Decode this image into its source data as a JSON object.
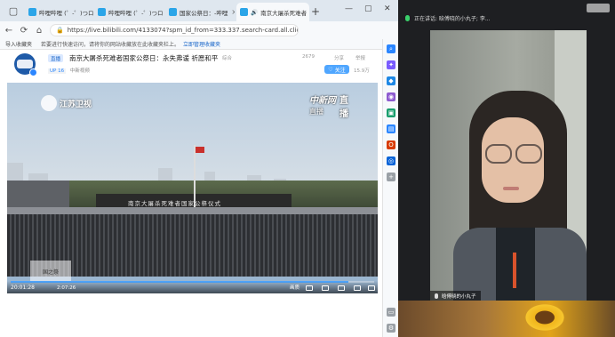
{
  "browser": {
    "tabs": [
      {
        "label": "哔哩哔哩 (゜-゜)つロ",
        "active": false
      },
      {
        "label": "哔哩哔哩 (゜-゜)つロ",
        "active": false
      },
      {
        "label": "国家公祭日：-哔哩",
        "active": false
      },
      {
        "label": "南京大屠杀死难者",
        "active": true
      }
    ],
    "url": "https://live.bilibili.com/41330?broadcast_type=0&is_room_feed=1&spm_id_from=333.337.search-card.all.click",
    "url_display": "https://live.bilibili.com/4133074?spm_id_from=333.337.search-card.all.click",
    "favbar": {
      "import": "导入收藏夹",
      "notice": "若要进行快速访问，请将你的网站收藏放在此收藏夹栏上。",
      "manage": "立即管理收藏夹"
    }
  },
  "stream": {
    "live_tag": "直播",
    "title": "南京大屠杀死难者国家公祭日：永失弗谖 祈愿和平",
    "meta_left": "综合",
    "meta_views": "2679",
    "meta_share": "分享",
    "meta_report": "举报",
    "uploader_sub_up": "UP 16",
    "uploader_sub_name": "中新视频",
    "follow_label": "关注",
    "fans": "15.9万"
  },
  "player": {
    "watermark_left": "江苏卫视",
    "watermark_right_a": "中新网",
    "watermark_right_b": "直播",
    "watermark_right_zb": "直播",
    "banner_text": "南京大屠杀死难者国家公祭仪式",
    "bl_watermark": "国之祭",
    "time": "2:07:26",
    "progress": 0.93,
    "left_time": "20:01:28",
    "ctl_quality": "画质"
  },
  "meeting": {
    "speaking": "正在讲话: 晗傅晓的小丸子; 李...",
    "participant_name": "晗傅晓的小丸子"
  },
  "colors": {
    "accent": "#4fa6ff",
    "speaking_green": "#3ad06b"
  }
}
